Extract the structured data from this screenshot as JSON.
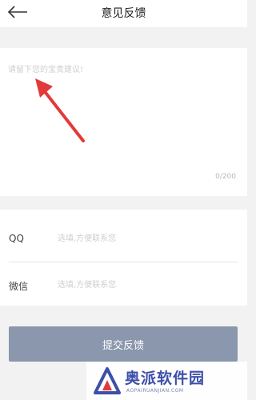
{
  "header": {
    "title": "意见反馈",
    "back_icon": "arrow-left-icon"
  },
  "feedback": {
    "placeholder": "请留下您的宝贵建议!",
    "value": "",
    "counter": "0/200"
  },
  "contact": {
    "qq": {
      "label": "QQ",
      "placeholder": "选填,方便联系您"
    },
    "wechat": {
      "label": "微信",
      "placeholder": "选填,方便联系您"
    }
  },
  "submit_label": "提交反馈",
  "watermark": {
    "text": "奥派软件园",
    "subtext": "AOPAIRUANJIAN.COM",
    "logo_icon": "triangle-logo-icon"
  },
  "annotation": {
    "icon": "red-arrow-icon",
    "color": "#e23a3a"
  },
  "colors": {
    "accent_button": "#8a97ac",
    "page_bg": "#f2f2f2",
    "watermark": "#3d4fa8"
  }
}
